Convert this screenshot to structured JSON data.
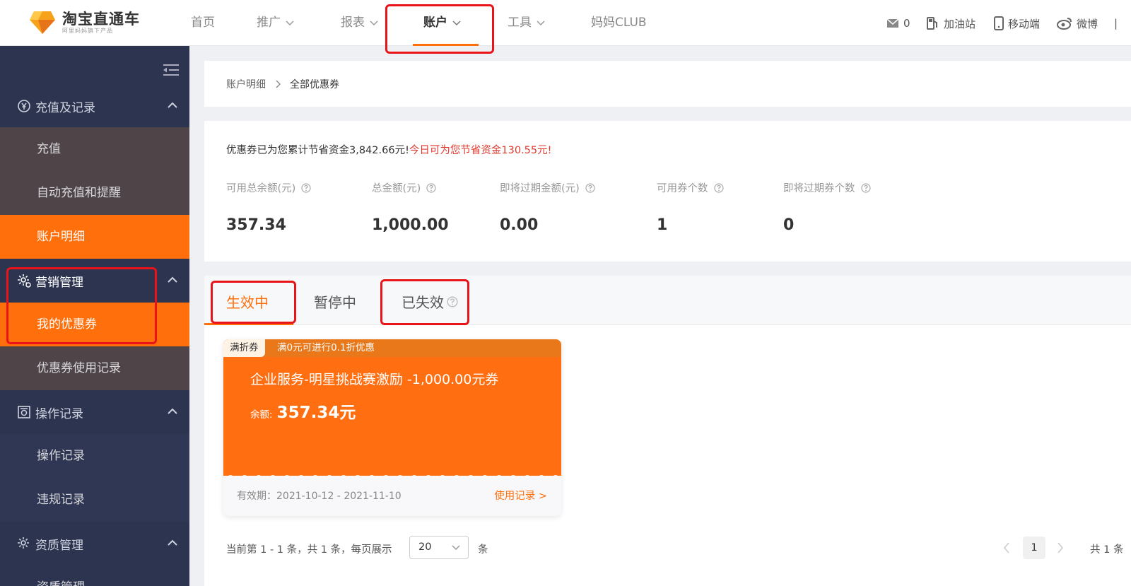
{
  "brand": {
    "title": "淘宝直通车",
    "subtitle": "阿里妈妈旗下产品"
  },
  "topnav": {
    "items": [
      {
        "label": "首页",
        "has_menu": false
      },
      {
        "label": "推广",
        "has_menu": true
      },
      {
        "label": "报表",
        "has_menu": true
      },
      {
        "label": "账户",
        "has_menu": true,
        "active": true
      },
      {
        "label": "工具",
        "has_menu": true
      },
      {
        "label": "妈妈CLUB",
        "has_menu": false
      }
    ],
    "messages_count": "0",
    "gas_station": "加油站",
    "mobile": "移动端",
    "weibo": "微博",
    "divider": "|"
  },
  "sidebar": {
    "groups": [
      {
        "label": "充值及记录",
        "icon": "yen-circle-icon",
        "items": [
          "充值",
          "自动充值和提醒",
          "账户明细"
        ]
      },
      {
        "label": "营销管理",
        "icon": "gear-marketing-icon",
        "items": [
          "我的优惠券",
          "优惠券使用记录"
        ]
      },
      {
        "label": "操作记录",
        "icon": "record-icon",
        "items": [
          "操作记录",
          "违规记录"
        ]
      },
      {
        "label": "资质管理",
        "icon": "gear-qualification-icon",
        "items": [
          "资质管理"
        ]
      }
    ]
  },
  "breadcrumb": {
    "parent": "账户明细",
    "current": "全部优惠券"
  },
  "summary": {
    "saving_text": "优惠券已为您累计节省资金3,842.66元!",
    "today_text": "今日可为您节省资金130.55元!",
    "stats": [
      {
        "label": "可用总余额(元)",
        "value": "357.34"
      },
      {
        "label": "总金额(元)",
        "value": "1,000.00"
      },
      {
        "label": "即将过期金额(元)",
        "value": "0.00"
      },
      {
        "label": "可用券个数",
        "value": "1"
      },
      {
        "label": "即将过期券个数",
        "value": "0"
      }
    ]
  },
  "tabs": [
    {
      "label": "生效中",
      "active": true
    },
    {
      "label": "暂停中"
    },
    {
      "label": "已失效"
    }
  ],
  "coupon": {
    "tag": "满折券",
    "condition": "满0元可进行0.1折优惠",
    "name": "企业服务-明星挑战赛激励 -1,000.00元券",
    "balance_label": "余额:",
    "balance_value": "357.34元",
    "validity": "有效期：2021-10-12 - 2021-11-10",
    "usage_link": "使用记录 >"
  },
  "pager": {
    "info": "当前第 1 - 1 条，共 1 条，每页展示",
    "page_size": "20",
    "unit": "条",
    "current_page": "1",
    "total": "共 1 条"
  },
  "colors": {
    "accent": "#ff6f0c",
    "sidebar": "#2d3450",
    "annotation": "#e8141a",
    "highlight_text": "#e03a2f"
  }
}
